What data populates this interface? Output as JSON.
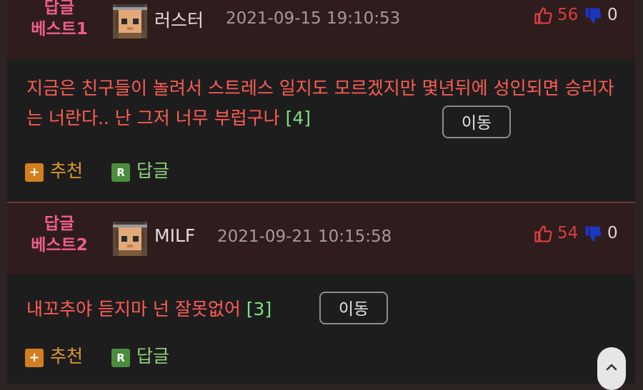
{
  "comments": [
    {
      "best_label_1": "답글",
      "best_label_2": "베스트1",
      "nickname": "러스터",
      "datetime": "2021-09-15 19:10:53",
      "upvotes": "56",
      "downvotes": "0",
      "text": "지금은 친구들이 놀려서 스트레스 일지도 모르겠지만 몇년뒤에 성인되면 승리자는 너란다.. 난 그저 너무 부럽구나",
      "reply_count": "[4]",
      "move_label": "이동",
      "recommend_label": "추천",
      "reply_label": "답글",
      "recommend_icon": "+",
      "reply_icon": "R"
    },
    {
      "best_label_1": "답글",
      "best_label_2": "베스트2",
      "nickname": "MILF",
      "datetime": "2021-09-21 10:15:58",
      "upvotes": "54",
      "downvotes": "0",
      "text": "내꼬추야 듣지마 넌 잘못없어",
      "reply_count": "[3]",
      "move_label": "이동",
      "recommend_label": "추천",
      "reply_label": "답글",
      "recommend_icon": "+",
      "reply_icon": "R"
    }
  ],
  "icons": {
    "thumbs_up": "thumbs-up-icon",
    "thumbs_down": "thumbs-down-icon",
    "avatar": "pixel-avatar-icon",
    "scroll_top": "chevron-up-icon"
  },
  "colors": {
    "background": "#1e1d1e",
    "header": "#2f1c1d",
    "best_label": "#ec5f88",
    "comment_text": "#ff5d54",
    "reply_count": "#7fe17f",
    "upvote": "#d93e3e",
    "downvote_icon": "#1b36c2",
    "recommend": "#de9a2d",
    "reply": "#8ed37a"
  }
}
